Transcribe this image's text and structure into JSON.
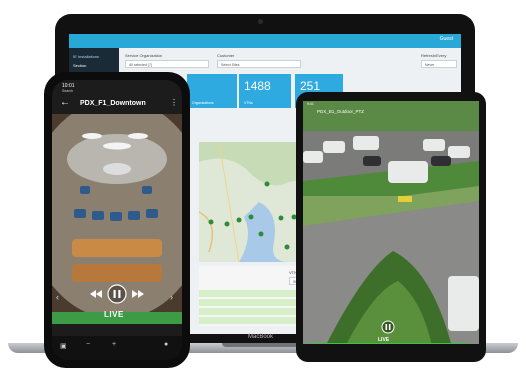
{
  "laptop": {
    "brand_label": "MacBook",
    "user_label": "Guest",
    "sidebar": {
      "heading": "IE Installations",
      "item": "Section"
    },
    "filters": {
      "org_label": "Service Organization",
      "org_value": "All selected (7)",
      "customer_label": "Customer",
      "customer_value": "Select Sites",
      "refresh_label": "Refresh/Every",
      "refresh_value": "Never"
    },
    "kpis": [
      {
        "value": "",
        "label": "Organizations"
      },
      {
        "value": "1488",
        "label": "VTNs"
      },
      {
        "value": "251",
        "label": ""
      }
    ],
    "table": {
      "status_label": "VTN Status",
      "status_value": "Show All"
    }
  },
  "phone": {
    "status_time": "10:01",
    "status_sub": "Search",
    "title": "PDX_F1_Downtown",
    "live_label": "LIVE",
    "icons": [
      "back-icon",
      "more-icon",
      "skip-back-icon",
      "pause-icon",
      "skip-forward-icon"
    ]
  },
  "tablet": {
    "title": "PDX_B1_Outdoor_PTZ",
    "live_label": "LIVE"
  }
}
